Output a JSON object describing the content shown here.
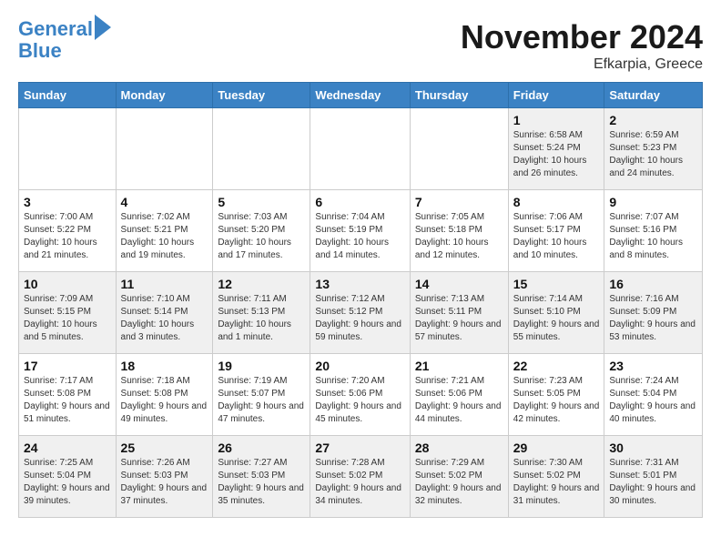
{
  "header": {
    "logo_line1": "General",
    "logo_line2": "Blue",
    "month": "November 2024",
    "location": "Efkarpia, Greece"
  },
  "weekdays": [
    "Sunday",
    "Monday",
    "Tuesday",
    "Wednesday",
    "Thursday",
    "Friday",
    "Saturday"
  ],
  "weeks": [
    [
      {
        "day": "",
        "info": ""
      },
      {
        "day": "",
        "info": ""
      },
      {
        "day": "",
        "info": ""
      },
      {
        "day": "",
        "info": ""
      },
      {
        "day": "",
        "info": ""
      },
      {
        "day": "1",
        "info": "Sunrise: 6:58 AM\nSunset: 5:24 PM\nDaylight: 10 hours and 26 minutes."
      },
      {
        "day": "2",
        "info": "Sunrise: 6:59 AM\nSunset: 5:23 PM\nDaylight: 10 hours and 24 minutes."
      }
    ],
    [
      {
        "day": "3",
        "info": "Sunrise: 7:00 AM\nSunset: 5:22 PM\nDaylight: 10 hours and 21 minutes."
      },
      {
        "day": "4",
        "info": "Sunrise: 7:02 AM\nSunset: 5:21 PM\nDaylight: 10 hours and 19 minutes."
      },
      {
        "day": "5",
        "info": "Sunrise: 7:03 AM\nSunset: 5:20 PM\nDaylight: 10 hours and 17 minutes."
      },
      {
        "day": "6",
        "info": "Sunrise: 7:04 AM\nSunset: 5:19 PM\nDaylight: 10 hours and 14 minutes."
      },
      {
        "day": "7",
        "info": "Sunrise: 7:05 AM\nSunset: 5:18 PM\nDaylight: 10 hours and 12 minutes."
      },
      {
        "day": "8",
        "info": "Sunrise: 7:06 AM\nSunset: 5:17 PM\nDaylight: 10 hours and 10 minutes."
      },
      {
        "day": "9",
        "info": "Sunrise: 7:07 AM\nSunset: 5:16 PM\nDaylight: 10 hours and 8 minutes."
      }
    ],
    [
      {
        "day": "10",
        "info": "Sunrise: 7:09 AM\nSunset: 5:15 PM\nDaylight: 10 hours and 5 minutes."
      },
      {
        "day": "11",
        "info": "Sunrise: 7:10 AM\nSunset: 5:14 PM\nDaylight: 10 hours and 3 minutes."
      },
      {
        "day": "12",
        "info": "Sunrise: 7:11 AM\nSunset: 5:13 PM\nDaylight: 10 hours and 1 minute."
      },
      {
        "day": "13",
        "info": "Sunrise: 7:12 AM\nSunset: 5:12 PM\nDaylight: 9 hours and 59 minutes."
      },
      {
        "day": "14",
        "info": "Sunrise: 7:13 AM\nSunset: 5:11 PM\nDaylight: 9 hours and 57 minutes."
      },
      {
        "day": "15",
        "info": "Sunrise: 7:14 AM\nSunset: 5:10 PM\nDaylight: 9 hours and 55 minutes."
      },
      {
        "day": "16",
        "info": "Sunrise: 7:16 AM\nSunset: 5:09 PM\nDaylight: 9 hours and 53 minutes."
      }
    ],
    [
      {
        "day": "17",
        "info": "Sunrise: 7:17 AM\nSunset: 5:08 PM\nDaylight: 9 hours and 51 minutes."
      },
      {
        "day": "18",
        "info": "Sunrise: 7:18 AM\nSunset: 5:08 PM\nDaylight: 9 hours and 49 minutes."
      },
      {
        "day": "19",
        "info": "Sunrise: 7:19 AM\nSunset: 5:07 PM\nDaylight: 9 hours and 47 minutes."
      },
      {
        "day": "20",
        "info": "Sunrise: 7:20 AM\nSunset: 5:06 PM\nDaylight: 9 hours and 45 minutes."
      },
      {
        "day": "21",
        "info": "Sunrise: 7:21 AM\nSunset: 5:06 PM\nDaylight: 9 hours and 44 minutes."
      },
      {
        "day": "22",
        "info": "Sunrise: 7:23 AM\nSunset: 5:05 PM\nDaylight: 9 hours and 42 minutes."
      },
      {
        "day": "23",
        "info": "Sunrise: 7:24 AM\nSunset: 5:04 PM\nDaylight: 9 hours and 40 minutes."
      }
    ],
    [
      {
        "day": "24",
        "info": "Sunrise: 7:25 AM\nSunset: 5:04 PM\nDaylight: 9 hours and 39 minutes."
      },
      {
        "day": "25",
        "info": "Sunrise: 7:26 AM\nSunset: 5:03 PM\nDaylight: 9 hours and 37 minutes."
      },
      {
        "day": "26",
        "info": "Sunrise: 7:27 AM\nSunset: 5:03 PM\nDaylight: 9 hours and 35 minutes."
      },
      {
        "day": "27",
        "info": "Sunrise: 7:28 AM\nSunset: 5:02 PM\nDaylight: 9 hours and 34 minutes."
      },
      {
        "day": "28",
        "info": "Sunrise: 7:29 AM\nSunset: 5:02 PM\nDaylight: 9 hours and 32 minutes."
      },
      {
        "day": "29",
        "info": "Sunrise: 7:30 AM\nSunset: 5:02 PM\nDaylight: 9 hours and 31 minutes."
      },
      {
        "day": "30",
        "info": "Sunrise: 7:31 AM\nSunset: 5:01 PM\nDaylight: 9 hours and 30 minutes."
      }
    ]
  ]
}
